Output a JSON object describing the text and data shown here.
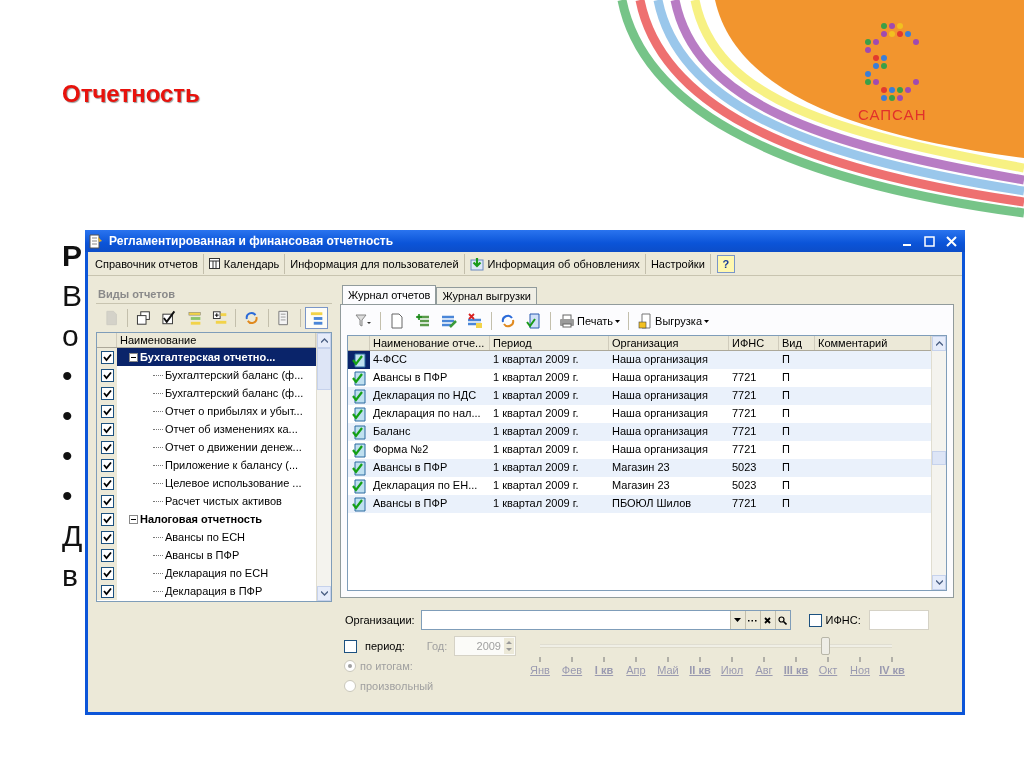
{
  "slide": {
    "title": "Отчетность",
    "logo_text": "САПСАН",
    "body_lines": [
      {
        "kind": "heading",
        "text": "Р"
      },
      {
        "kind": "text",
        "text": "В"
      },
      {
        "kind": "text",
        "text": "о"
      },
      {
        "kind": "bullet",
        "text": "•"
      },
      {
        "kind": "bullet",
        "text": "•"
      },
      {
        "kind": "bullet",
        "text": "•"
      },
      {
        "kind": "bullet",
        "text": "•"
      },
      {
        "kind": "text",
        "text": "Д"
      },
      {
        "kind": "text",
        "text": "в"
      }
    ]
  },
  "window": {
    "title": "Регламентированная и финансовая отчетность",
    "menu": [
      {
        "kind": "text",
        "label": "Справочник отчетов"
      },
      {
        "kind": "calendar",
        "label": "Календарь"
      },
      {
        "kind": "text",
        "label": "Информация для пользователей"
      },
      {
        "kind": "update",
        "label": "Информация об обновлениях"
      },
      {
        "kind": "text",
        "label": "Настройки"
      },
      {
        "kind": "help",
        "label": "?"
      }
    ]
  },
  "report_types": {
    "title": "Виды отчетов",
    "column": "Наименование",
    "toolbar": [
      {
        "kind": "new",
        "disabled": true,
        "pressed": false
      },
      {
        "kind": "copy",
        "disabled": false,
        "pressed": false
      },
      {
        "kind": "check",
        "disabled": false,
        "pressed": false
      },
      {
        "kind": "list",
        "disabled": false,
        "pressed": false
      },
      {
        "kind": "list-plus",
        "disabled": false,
        "pressed": false
      },
      {
        "kind": "refresh",
        "disabled": false,
        "pressed": false
      },
      {
        "kind": "doc-lines",
        "disabled": false,
        "pressed": false
      },
      {
        "kind": "hierarchy",
        "disabled": false,
        "pressed": true
      }
    ],
    "tree": [
      {
        "label": "Бухгалтерская отчетно...",
        "checked": true,
        "expanded": true,
        "selected": true,
        "children": [
          {
            "label": "Бухгалтерский баланс (ф...",
            "checked": true,
            "selected": false
          },
          {
            "label": "Бухгалтерский баланс (ф...",
            "checked": true,
            "selected": false
          },
          {
            "label": "Отчет о прибылях и убыт...",
            "checked": true,
            "selected": false
          },
          {
            "label": "Отчет об изменениях ка...",
            "checked": true,
            "selected": false
          },
          {
            "label": "Отчет о движении денеж...",
            "checked": true,
            "selected": false
          },
          {
            "label": "Приложение к балансу (...",
            "checked": true,
            "selected": false
          },
          {
            "label": "Целевое использование ...",
            "checked": true,
            "selected": false
          },
          {
            "label": "Расчет чистых активов",
            "checked": true,
            "selected": false
          }
        ]
      },
      {
        "label": "Налоговая отчетность",
        "checked": true,
        "expanded": true,
        "selected": false,
        "children": [
          {
            "label": "Авансы по ЕСН",
            "checked": true,
            "selected": false
          },
          {
            "label": "Авансы в ПФР",
            "checked": true,
            "selected": false
          },
          {
            "label": "Декларация по ЕСН",
            "checked": true,
            "selected": false
          },
          {
            "label": "Декларация в ПФР",
            "checked": true,
            "selected": false
          }
        ]
      }
    ]
  },
  "tabs": [
    {
      "label": "Журнал отчетов",
      "selected": true
    },
    {
      "label": "Журнал выгрузки",
      "selected": false
    }
  ],
  "journal": {
    "toolbar": [
      {
        "kind": "filter"
      },
      {
        "kind": "new"
      },
      {
        "kind": "list-add"
      },
      {
        "kind": "list-edit"
      },
      {
        "kind": "list-delete"
      },
      {
        "kind": "refresh"
      },
      {
        "kind": "doc-check"
      },
      {
        "kind": "print",
        "label": "Печать"
      },
      {
        "kind": "export",
        "label": "Выгрузка"
      }
    ],
    "columns": [
      "Наименование отче...",
      "Период",
      "Организация",
      "ИФНС",
      "Вид",
      "Комментарий"
    ],
    "rows": [
      {
        "name": "4-ФСС",
        "period": "1 квартал 2009 г.",
        "organization": "Наша организация",
        "type": "П",
        "selected": true
      },
      {
        "name": "Авансы в ПФР",
        "period": "1 квартал 2009 г.",
        "organization": "Наша организация",
        "ifns": "7721",
        "type": "П",
        "selected": false
      },
      {
        "name": "Декларация по НДС",
        "period": "1 квартал 2009 г.",
        "organization": "Наша организация",
        "ifns": "7721",
        "type": "П",
        "selected": false
      },
      {
        "name": "Декларация по нал...",
        "period": "1 квартал 2009 г.",
        "organization": "Наша организация",
        "ifns": "7721",
        "type": "П",
        "selected": false
      },
      {
        "name": "Баланс",
        "period": "1 квартал 2009 г.",
        "organization": "Наша организация",
        "ifns": "7721",
        "type": "П",
        "selected": false
      },
      {
        "name": "Форма №2",
        "period": "1 квартал 2009 г.",
        "organization": "Наша организация",
        "ifns": "7721",
        "type": "П",
        "selected": false
      },
      {
        "name": "Авансы в ПФР",
        "period": "1 квартал 2009 г.",
        "organization": "Магазин 23",
        "ifns": "5023",
        "type": "П",
        "selected": false
      },
      {
        "name": "Декларация по ЕН...",
        "period": "1 квартал 2009 г.",
        "organization": "Магазин 23",
        "ifns": "5023",
        "type": "П",
        "selected": false
      },
      {
        "name": "Авансы в ПФР",
        "period": "1 квартал 2009 г.",
        "organization": "ПБОЮЛ  Шилов",
        "ifns": "7721",
        "type": "П",
        "selected": false
      }
    ]
  },
  "filters": {
    "organizations_label": "Организации:",
    "ifns": {
      "label": "ИФНС:",
      "checked": false
    },
    "period": {
      "label": "период:",
      "checked": false,
      "year_label": "Год:",
      "year": "2009",
      "level": 0.81,
      "modes": [
        {
          "label": "по итогам:",
          "selected": true
        },
        {
          "label": "произвольный",
          "selected": false
        }
      ],
      "months": [
        {
          "kind": "month",
          "label": "Янв"
        },
        {
          "kind": "month",
          "label": "Фев"
        },
        {
          "kind": "quarter",
          "label": "I кв"
        },
        {
          "kind": "month",
          "label": "Апр"
        },
        {
          "kind": "month",
          "label": "Май"
        },
        {
          "kind": "quarter",
          "label": "II кв"
        },
        {
          "kind": "month",
          "label": "Июл"
        },
        {
          "kind": "month",
          "label": "Авг"
        },
        {
          "kind": "quarter",
          "label": "III кв"
        },
        {
          "kind": "month",
          "label": "Окт"
        },
        {
          "kind": "month",
          "label": "Ноя"
        },
        {
          "kind": "quarter",
          "label": "IV кв"
        }
      ]
    }
  }
}
